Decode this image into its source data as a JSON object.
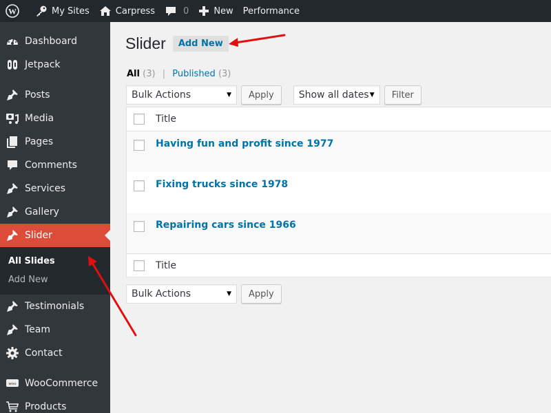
{
  "adminbar": {
    "wp_logo": "wordpress-logo",
    "items": [
      {
        "label": "My Sites",
        "icon": "key-icon"
      },
      {
        "label": "Carpress",
        "icon": "home-icon"
      },
      {
        "label": "",
        "icon": "comment-icon",
        "count": "0"
      },
      {
        "label": "New",
        "icon": "plus-icon"
      },
      {
        "label": "Performance"
      }
    ]
  },
  "sidebar": {
    "items": [
      {
        "label": "Dashboard",
        "icon": "dashboard-icon"
      },
      {
        "label": "Jetpack",
        "icon": "jetpack-icon"
      },
      {
        "label": "Posts",
        "icon": "pin-icon"
      },
      {
        "label": "Media",
        "icon": "media-icon"
      },
      {
        "label": "Pages",
        "icon": "pages-icon"
      },
      {
        "label": "Comments",
        "icon": "comment-icon"
      },
      {
        "label": "Services",
        "icon": "pin-icon"
      },
      {
        "label": "Gallery",
        "icon": "pin-icon"
      },
      {
        "label": "Slider",
        "icon": "pin-icon",
        "active": true
      },
      {
        "label": "Testimonials",
        "icon": "pin-icon"
      },
      {
        "label": "Team",
        "icon": "pin-icon"
      },
      {
        "label": "Contact",
        "icon": "gear-icon"
      },
      {
        "label": "WooCommerce",
        "icon": "woo-icon"
      },
      {
        "label": "Products",
        "icon": "cart-icon"
      }
    ],
    "submenu": [
      {
        "label": "All Slides",
        "current": true
      },
      {
        "label": "Add New"
      }
    ],
    "active_color": "#dd4b39"
  },
  "main": {
    "title": "Slider",
    "add_new_label": "Add New",
    "views": {
      "all_label": "All",
      "all_count": "(3)",
      "separator": "|",
      "published_label": "Published",
      "published_count": "(3)"
    },
    "bulk_actions": "Bulk Actions",
    "apply_label": "Apply",
    "date_filter": "Show all dates",
    "filter_label": "Filter",
    "column_title": "Title",
    "rows": [
      {
        "title": "Having fun and profit since 1977"
      },
      {
        "title": "Fixing trucks since 1978"
      },
      {
        "title": "Repairing cars since 1966"
      }
    ],
    "link_color": "#0073aa"
  },
  "annotations": {
    "arrow_color": "#e01010"
  }
}
